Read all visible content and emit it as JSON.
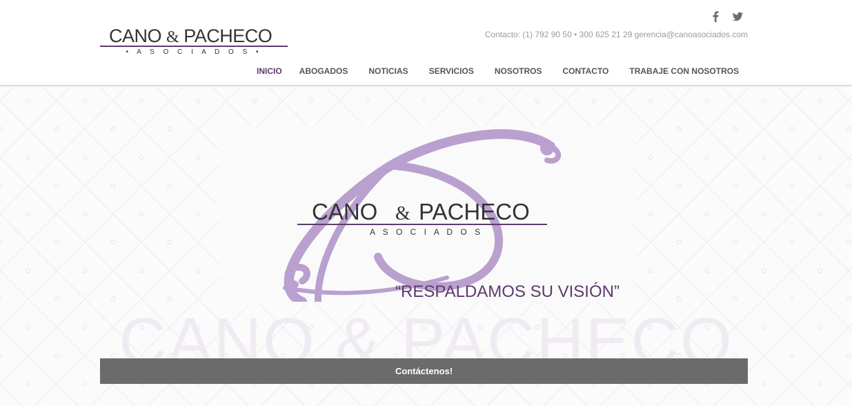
{
  "header": {
    "logo": {
      "word_left": "CANO",
      "ampersand": "&",
      "word_right": "PACHECO",
      "subtitle": "• A S O C I A D O S •"
    },
    "social": [
      {
        "icon": "facebook-icon"
      },
      {
        "icon": "twitter-icon"
      }
    ],
    "contact_text": "Contacto: (1) 792 90 50 • 300 625 21 29 gerencia@canoasociados.com",
    "nav": [
      {
        "label": "INICIO",
        "active": true
      },
      {
        "label": "ABOGADOS",
        "active": false
      },
      {
        "label": "NOTICIAS",
        "active": false
      },
      {
        "label": "SERVICIOS",
        "active": false
      },
      {
        "label": "NOSOTROS",
        "active": false
      },
      {
        "label": "CONTACTO",
        "active": false
      },
      {
        "label": "TRABAJE CON NOSOTROS",
        "active": false
      }
    ]
  },
  "banner": {
    "word_left": "CANO",
    "ampersand": "&",
    "word_right": "PACHECO",
    "subtitle": "A S O C I A D O S",
    "slogan": "“RESPALDAMOS SU VISIÓN”"
  },
  "watermark": "CANO & PACHECO",
  "cta_label": "Contáctenos!",
  "colors": {
    "brand_purple": "#5e3a6b",
    "flourish_lilac": "#b9a0cf",
    "cta_gray": "#6b6b6b"
  }
}
